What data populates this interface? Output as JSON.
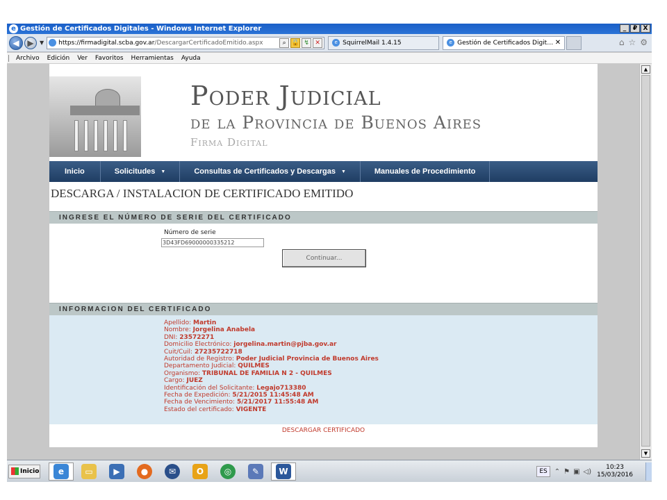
{
  "window": {
    "title": "Gestión de Certificados Digitales - Windows Internet Explorer",
    "buttons": [
      "_",
      "₽",
      "X"
    ]
  },
  "browser": {
    "address_https": "https://",
    "address_host": "firmadigital.scba.gov.ar",
    "address_path": "/DescargarCertificadoEmitido.aspx",
    "tabs": [
      {
        "label": "SquirrelMail 1.4.15"
      },
      {
        "label": "Gestión de Certificados Digit…"
      }
    ],
    "tab_close": "✕"
  },
  "menubar": [
    "Archivo",
    "Edición",
    "Ver",
    "Favoritos",
    "Herramientas",
    "Ayuda"
  ],
  "page": {
    "brand_line1": "Poder Judicial",
    "brand_line2": "de la Provincia de Buenos Aires",
    "brand_line3": "Firma Digital",
    "nav": [
      {
        "label": "Inicio"
      },
      {
        "label": "Solicitudes"
      },
      {
        "label": "Consultas de Certificados y Descargas"
      },
      {
        "label": "Manuales de Procedimiento"
      }
    ],
    "heading": "DESCARGA / INSTALACION DE CERTIFICADO EMITIDO",
    "section_serial": "INGRESE EL NÚMERO DE SERIE DEL CERTIFICADO",
    "serial_label": "Número de serie",
    "serial_value": "3D43FD69000000335212",
    "continue_label": "Continuar...",
    "section_info": "INFORMACION DEL CERTIFICADO",
    "info": [
      {
        "label": "Apellido: ",
        "value": "Martin"
      },
      {
        "label": "Nombre: ",
        "value": "Jorgelina Anabela"
      },
      {
        "label": "DNI: ",
        "value": "23572271"
      },
      {
        "label": "Domicilio Electrónico: ",
        "value": "jorgelina.martin@pjba.gov.ar"
      },
      {
        "label": "Cuit/Cuil: ",
        "value": "27235722718"
      },
      {
        "label": "Autoridad de Registro: ",
        "value": "Poder Judicial Provincia de Buenos Aires"
      },
      {
        "label": "Departamento Judicial: ",
        "value": "QUILMES"
      },
      {
        "label": "Organismo: ",
        "value": "TRIBUNAL DE FAMILIA N 2 - QUILMES"
      },
      {
        "label": "Cargo: ",
        "value": "JUEZ"
      },
      {
        "label": "Identificación del Solicitante: ",
        "value": "Legajo713380"
      },
      {
        "label": "Fecha de Expedición: ",
        "value": "5/21/2015 11:45:48 AM"
      },
      {
        "label": "Fecha de Vencimiento: ",
        "value": "5/21/2017 11:55:48 AM"
      },
      {
        "label": "Estado del certificado: ",
        "value": "VIGENTE"
      }
    ],
    "download_label": "DESCARGAR CERTIFICADO"
  },
  "taskbar": {
    "start_label": "Inicio",
    "lang": "ES",
    "time": "10:23",
    "date": "15/03/2016"
  },
  "colors": {
    "nav_bg": "#2a4a73",
    "info_text": "#c0392b",
    "section_bar": "#bcc7c7",
    "info_bg": "#dbeaf3"
  }
}
